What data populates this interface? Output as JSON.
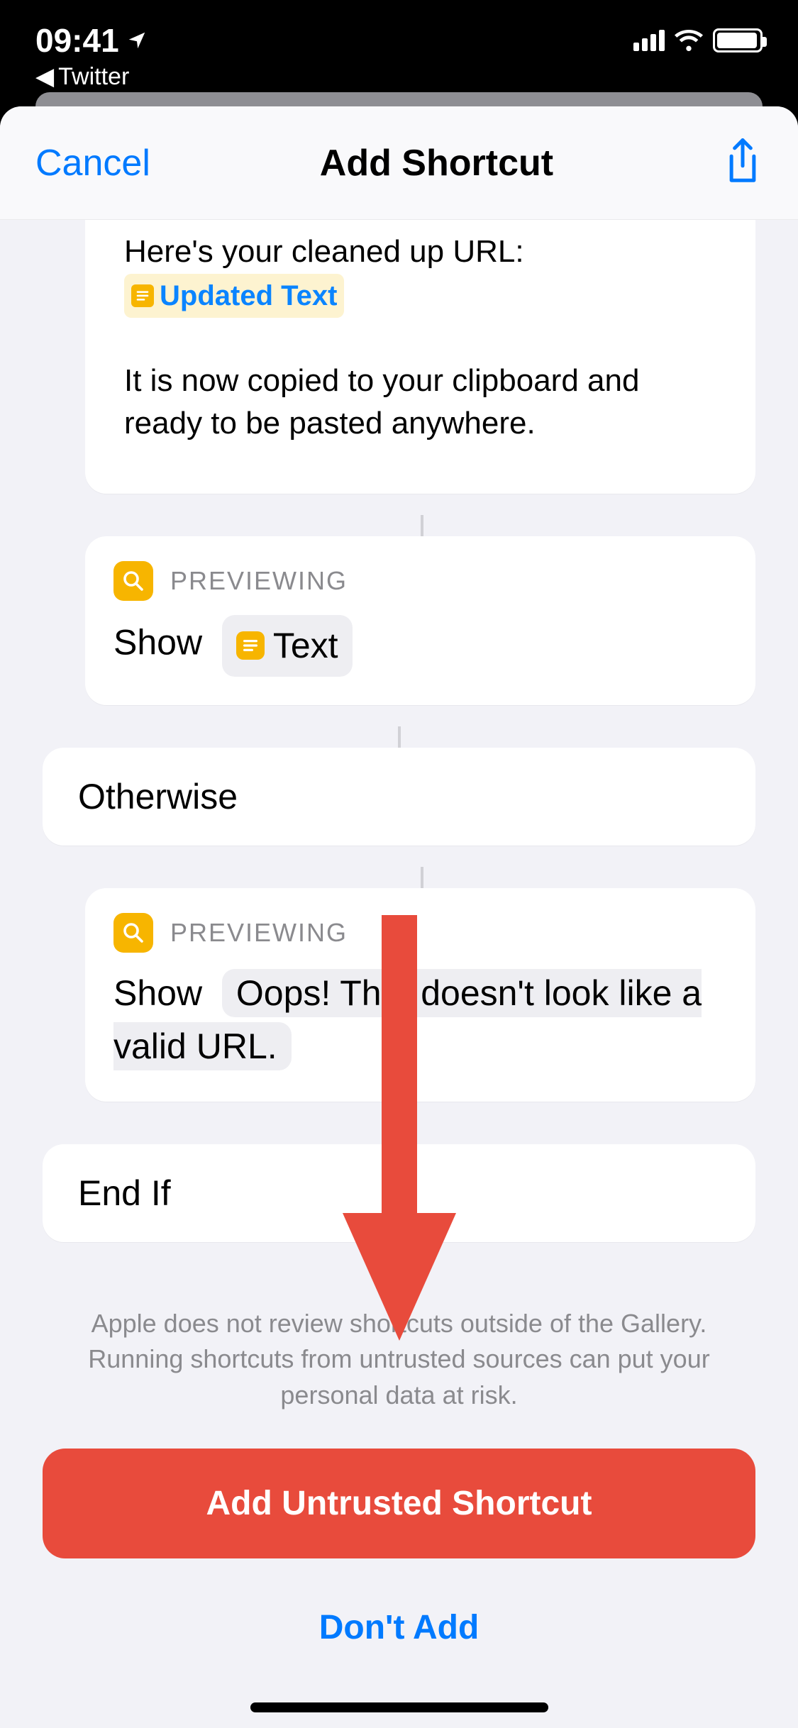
{
  "status": {
    "time": "09:41",
    "back_app": "Twitter"
  },
  "nav": {
    "cancel": "Cancel",
    "title": "Add Shortcut"
  },
  "actions": {
    "text_block": {
      "line1": "Here's your cleaned up URL:",
      "token": "Updated Text",
      "line2": "It is now copied to your clipboard and ready to be pasted anywhere."
    },
    "preview1": {
      "header": "PREVIEWING",
      "verb": "Show",
      "pill": "Text"
    },
    "otherwise": "Otherwise",
    "preview2": {
      "header": "PREVIEWING",
      "verb": "Show",
      "message": "Oops! That doesn't look like a valid URL."
    },
    "endif": "End If"
  },
  "footer": {
    "warning": "Apple does not review shortcuts outside of the Gallery. Running shortcuts from untrusted sources can put your personal data at risk.",
    "primary": "Add Untrusted Shortcut",
    "secondary": "Don't Add"
  }
}
